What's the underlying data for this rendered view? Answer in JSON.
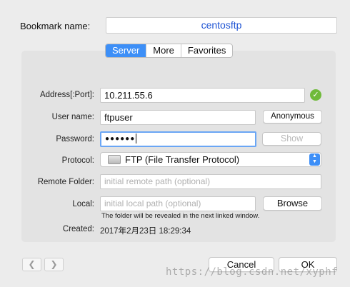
{
  "bookmark": {
    "label": "Bookmark name:",
    "value": "centosftp",
    "color": "#1f54d4"
  },
  "tabs": [
    {
      "label": "Server",
      "active": true
    },
    {
      "label": "More",
      "active": false
    },
    {
      "label": "Favorites",
      "active": false
    }
  ],
  "form": {
    "address": {
      "label": "Address[:Port]:",
      "value": "10.211.55.6",
      "status_icon": "checkmark-circle-icon",
      "status_color": "#6fba3a"
    },
    "username": {
      "label": "User name:",
      "value": "ftpuser",
      "anonymous_label": "Anonymous"
    },
    "password": {
      "label": "Password:",
      "value": "●●●●●●",
      "show_label": "Show"
    },
    "protocol": {
      "label": "Protocol:",
      "value": "FTP (File Transfer Protocol)",
      "icon": "drive-icon"
    },
    "remote_folder": {
      "label": "Remote Folder:",
      "placeholder": "initial remote path (optional)"
    },
    "local": {
      "label": "Local:",
      "placeholder": "initial local path (optional)",
      "browse_label": "Browse",
      "hint": "The folder will be revealed in the next linked window."
    },
    "created": {
      "label": "Created:",
      "value": "2017年2月23日 18:29:34"
    }
  },
  "footer": {
    "back_icon": "chevron-left-icon",
    "forward_icon": "chevron-right-icon",
    "cancel_label": "Cancel",
    "ok_label": "OK"
  },
  "watermark": "https://blog.csdn.net/xyphf",
  "accent": "#3d8ff7"
}
